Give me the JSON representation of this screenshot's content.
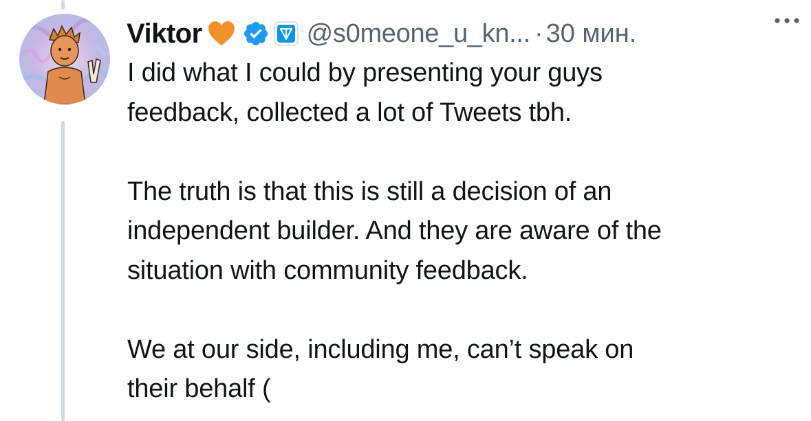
{
  "tweet": {
    "author_name": "Viktor",
    "handle": "@s0meone_u_kn...",
    "separator": "·",
    "time": "30 мин.",
    "paragraphs": [
      [
        "I did what I could by presenting your guys",
        "feedback, collected a lot of Tweets tbh."
      ],
      [
        "The truth is that this is still a decision of an",
        "independent builder. And they are aware of the",
        "situation with community feedback."
      ],
      [
        "We at our side, including me, can’t speak on",
        "their behalf ("
      ]
    ]
  },
  "icons": {
    "heart": "orange-heart-emoji",
    "verified": "verified-badge-icon",
    "affiliate": "ton-affiliate-badge-icon",
    "more": "more-options-icon",
    "avatar": "profile-avatar"
  },
  "colors": {
    "text": "#0f1419",
    "secondary_text": "#536471",
    "verified_blue": "#1d9bf0",
    "heart_orange": "#f4902a",
    "thread_line": "#cfd9de"
  }
}
